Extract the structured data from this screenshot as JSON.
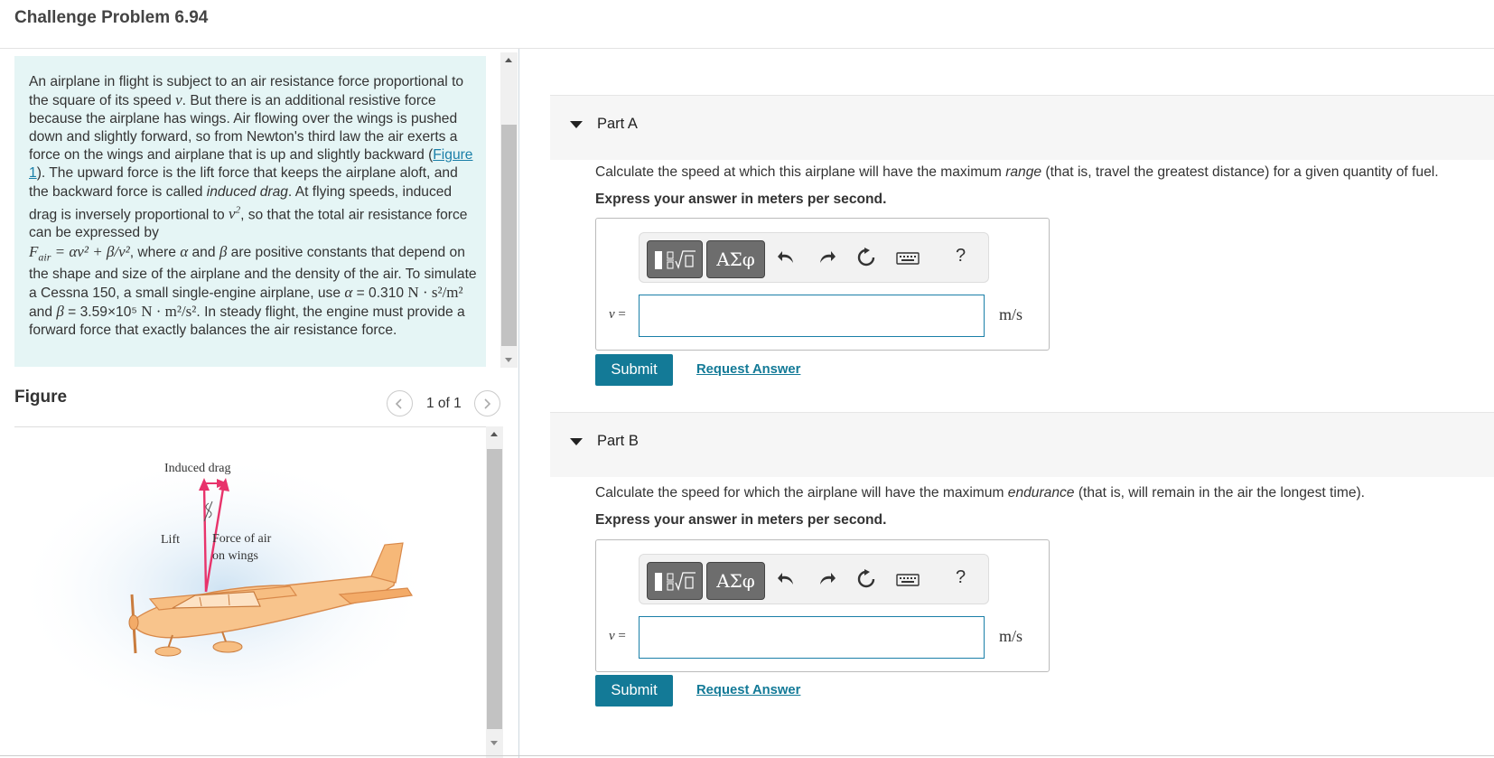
{
  "page": {
    "title": "Challenge Problem 6.94"
  },
  "problem": {
    "t1": "An airplane in flight is subject to an air resistance force proportional to the square of its speed ",
    "v": "v",
    "t2": ". But there is an additional resistive force because the airplane has wings. Air flowing over the wings is pushed down and slightly forward, so from Newton's third law the air exerts a force on the wings and airplane that is up and slightly backward (",
    "figure_link": "Figure 1",
    "t3": "). The upward force is the lift force that keeps the airplane aloft, and the backward force is called ",
    "induced_drag": "induced drag",
    "t4": ". At flying speeds, induced drag is inversely proportional to ",
    "t5": ", so that the total air resistance force can be expressed by",
    "formula_lhs": "F",
    "formula_sub": "air",
    "formula_rhs": " = αv² + β/v²",
    "t6": ", where ",
    "alpha": "α",
    "t7": " and ",
    "beta": "β",
    "t8": " are positive constants that depend on the shape and size of the airplane and the density of the air. To simulate a Cessna 150, a small single-engine airplane, use ",
    "alpha_value": " = 0.310 ",
    "alpha_unit": "N · s²/m²",
    "t9": " and ",
    "beta_value": " = 3.59×10⁵ ",
    "beta_unit": "N · m²/s²",
    "t10": ". In steady flight, the engine must provide a forward force that exactly balances the air resistance force."
  },
  "figure": {
    "label": "Figure",
    "pager": "1 of 1",
    "induced_drag": "Induced drag",
    "lift": "Lift",
    "force_line1": "Force of air",
    "force_line2": "on wings"
  },
  "toolbar": {
    "greek": "ΑΣφ",
    "help": "?"
  },
  "parts": [
    {
      "title": "Part A",
      "q_pre": "Calculate the speed at which this airplane will have the maximum ",
      "q_em": "range",
      "q_post": " (that is, travel the greatest distance) for a given quantity of fuel.",
      "instruction": "Express your answer in meters per second.",
      "var": "v",
      "eq": " =",
      "value": "",
      "unit": "m/s",
      "submit": "Submit",
      "request": "Request Answer"
    },
    {
      "title": "Part B",
      "q_pre": "Calculate the speed for which the airplane will have the maximum ",
      "q_em": "endurance",
      "q_post": " (that is, will remain in the air the longest time).",
      "instruction": "Express your answer in meters per second.",
      "var": "v",
      "eq": " =",
      "value": "",
      "unit": "m/s",
      "submit": "Submit",
      "request": "Request Answer"
    }
  ],
  "colors": {
    "accent": "#137a97",
    "problem_bg": "#e5f5f5",
    "link": "#1a7fa8"
  }
}
